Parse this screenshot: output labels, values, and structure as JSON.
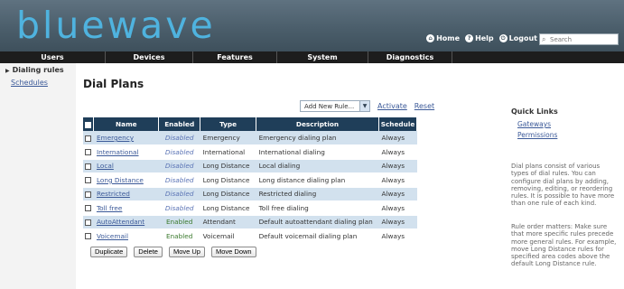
{
  "app": {
    "logo": "bluewave"
  },
  "toplinks": {
    "home": "Home",
    "help": "Help",
    "logout": "Logout"
  },
  "search": {
    "placeholder": "Search"
  },
  "nav": {
    "users": "Users",
    "devices": "Devices",
    "features": "Features",
    "system": "System",
    "diagnostics": "Diagnostics"
  },
  "sidebar": {
    "active": "Dialing rules",
    "link": "Schedules"
  },
  "page": {
    "title": "Dial Plans"
  },
  "controls": {
    "add_rule": "Add New Rule...",
    "activate": "Activate",
    "reset": "Reset"
  },
  "table": {
    "headers": {
      "name": "Name",
      "enabled": "Enabled",
      "type": "Type",
      "description": "Description",
      "schedule": "Schedule"
    },
    "rows": [
      {
        "name": "Emergency",
        "enabled": "Disabled",
        "type": "Emergency",
        "description": "Emergency dialing plan",
        "schedule": "Always"
      },
      {
        "name": "International",
        "enabled": "Disabled",
        "type": "International",
        "description": "International dialing",
        "schedule": "Always"
      },
      {
        "name": "Local",
        "enabled": "Disabled",
        "type": "Long Distance",
        "description": "Local dialing",
        "schedule": "Always"
      },
      {
        "name": "Long Distance",
        "enabled": "Disabled",
        "type": "Long Distance",
        "description": "Long distance dialing plan",
        "schedule": "Always"
      },
      {
        "name": "Restricted",
        "enabled": "Disabled",
        "type": "Long Distance",
        "description": "Restricted dialing",
        "schedule": "Always"
      },
      {
        "name": "Toll free",
        "enabled": "Disabled",
        "type": "Long Distance",
        "description": "Toll free dialing",
        "schedule": "Always"
      },
      {
        "name": "AutoAttendant",
        "enabled": "Enabled",
        "type": "Attendant",
        "description": "Default autoattendant dialing plan",
        "schedule": "Always"
      },
      {
        "name": "Voicemail",
        "enabled": "Enabled",
        "type": "Voicemail",
        "description": "Default voicemail dialing plan",
        "schedule": "Always"
      }
    ]
  },
  "buttons": {
    "duplicate": "Duplicate",
    "delete": "Delete",
    "move_up": "Move Up",
    "move_down": "Move Down"
  },
  "quick_links": {
    "title": "Quick Links",
    "gateways": "Gateways",
    "permissions": "Permissions"
  },
  "help": {
    "p1": "Dial plans consist of various types of dial rules. You can configure dial plans by adding, removing, editing, or reordering rules. It is possible to have more than one rule of each kind.",
    "p2": "Rule order matters: Make sure that more specific rules precede more general rules. For example, move Long Distance rules for specified area codes above the default Long Distance rule."
  },
  "colors": {
    "header": "#4b5e6b",
    "logo": "#4fb3df",
    "navbar": "#1d1d1d",
    "table_header": "#1f3e59",
    "row_alt": "#d2e1ee",
    "link": "#3b5998"
  }
}
